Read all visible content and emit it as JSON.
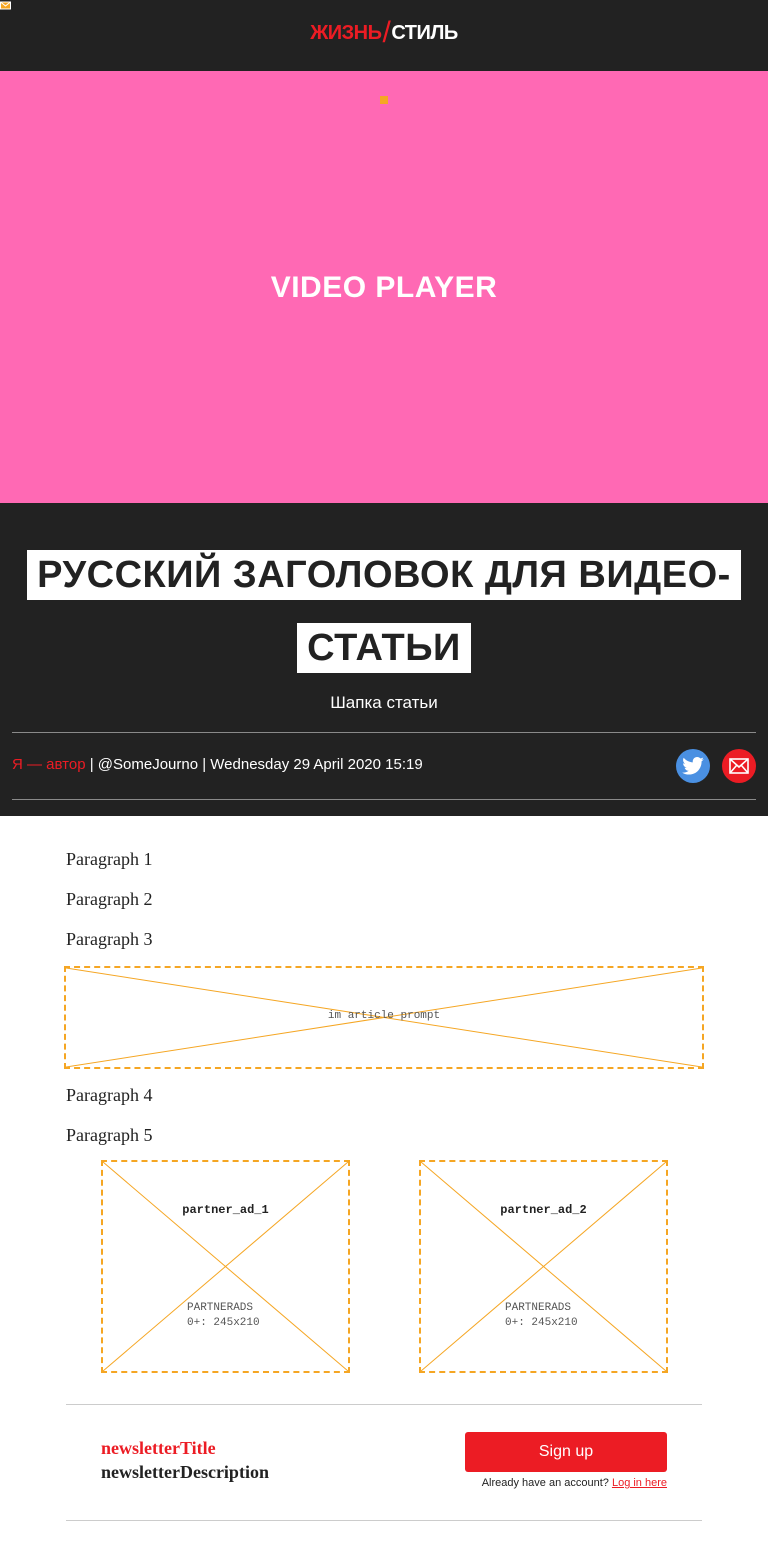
{
  "logo": {
    "part1": "ЖИЗНЬ",
    "separator": "/",
    "part2": "СТИЛЬ"
  },
  "icons": {
    "corner": "envelope-icon",
    "twitter": "twitter-icon",
    "email": "envelope-icon"
  },
  "video": {
    "label": "VIDEO PLAYER"
  },
  "article": {
    "headline": "РУССКИЙ ЗАГОЛОВОК ДЛЯ ВИДЕО-СТАТЬИ",
    "standfirst": "Шапка статьи",
    "byline": {
      "author": "Я — автор",
      "sep1": " | ",
      "handle": "@SomeJourno",
      "sep2": " | ",
      "date": "Wednesday 29 April 2020 15:19"
    },
    "paragraphs": [
      "Paragraph 1",
      "Paragraph 2",
      "Paragraph 3",
      "Paragraph 4",
      "Paragraph 5"
    ]
  },
  "prompt": {
    "label": "im article prompt"
  },
  "ads": [
    {
      "title": "partner_ad_1",
      "line1": "PARTNERADS",
      "line2": "0+: 245x210"
    },
    {
      "title": "partner_ad_2",
      "line1": "PARTNERADS",
      "line2": "0+: 245x210"
    }
  ],
  "newsletter": {
    "title": "newsletterTitle",
    "description": "newsletterDescription",
    "signup_label": "Sign up",
    "login_prompt": "Already have an account? ",
    "login_link": "Log in here"
  },
  "colors": {
    "brand_red": "#ec1c24",
    "dark": "#222222",
    "video_bg": "#ff69b4",
    "placeholder": "#f5a623",
    "twitter_blue": "#4a90e2"
  }
}
